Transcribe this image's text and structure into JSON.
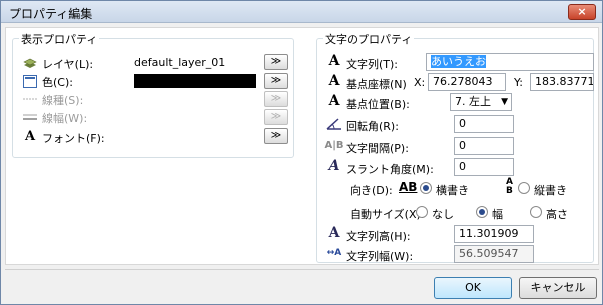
{
  "window": {
    "title": "プロパティ編集",
    "close_label": "×"
  },
  "display_props": {
    "title": "表示プロパティ",
    "layer_label": "レイヤ(L):",
    "layer_value": "default_layer_01",
    "color_label": "色(C):",
    "color_value": "#000000",
    "linetype_label": "線種(S):",
    "linewidth_label": "線幅(W):",
    "font_label": "フォント(F):",
    "more_label": "≫"
  },
  "text_props": {
    "title": "文字のプロパティ",
    "string_label": "文字列(T):",
    "string_value": "あいうえお",
    "base_coord_label": "基点座標(N)",
    "x_label": "X:",
    "x_value": "76.278043",
    "y_label": "Y:",
    "y_value": "183.83771",
    "base_pos_label": "基点位置(B):",
    "base_pos_value": "7. 左上",
    "rotation_label": "回転角(R):",
    "rotation_value": "0",
    "spacing_label": "文字間隔(P):",
    "spacing_value": "0",
    "slant_label": "スラント角度(M):",
    "slant_value": "0",
    "direction_label": "向き(D):",
    "horizontal_label": "横書き",
    "vertical_label": "縦書き",
    "autosize_label": "自動サイズ(X):",
    "autosize_none": "なし",
    "autosize_width": "幅",
    "autosize_height": "高さ",
    "height_label": "文字列高(H):",
    "height_value": "11.301909",
    "width_label": "文字列幅(W):",
    "width_value": "56.509547"
  },
  "buttons": {
    "ok": "OK",
    "cancel": "キャンセル"
  }
}
